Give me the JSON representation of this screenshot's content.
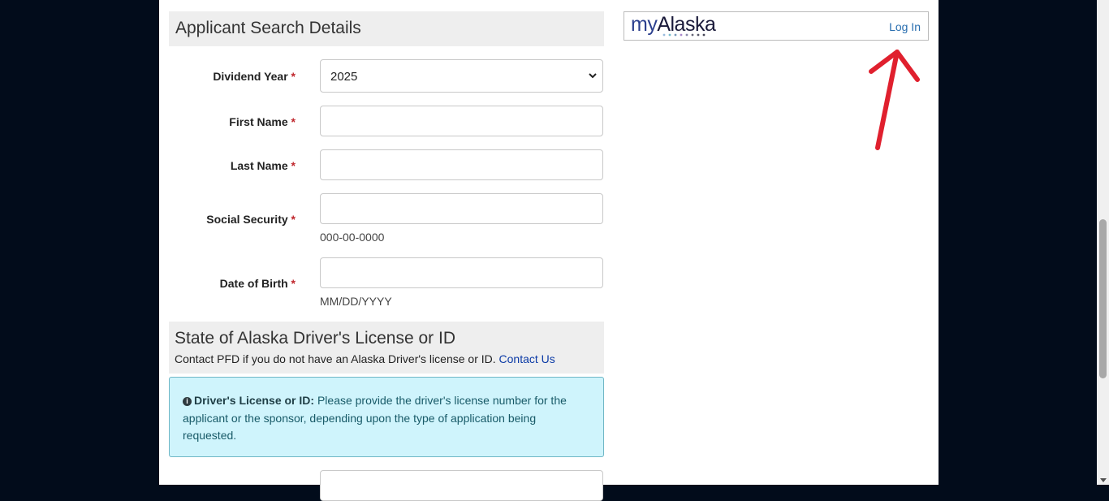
{
  "section1": {
    "title": "Applicant Search Details"
  },
  "form": {
    "dividend_year": {
      "label": "Dividend Year",
      "required": "*",
      "value": "2025"
    },
    "first_name": {
      "label": "First Name",
      "required": "*",
      "value": ""
    },
    "last_name": {
      "label": "Last Name",
      "required": "*",
      "value": ""
    },
    "ssn": {
      "label": "Social Security",
      "required": "*",
      "value": "",
      "hint": "000-00-0000"
    },
    "dob": {
      "label": "Date of Birth",
      "required": "*",
      "value": "",
      "hint": "MM/DD/YYYY"
    }
  },
  "section2": {
    "title": "State of Alaska Driver's License or ID",
    "subtitle": "Contact PFD if you do not have an Alaska Driver's license or ID.",
    "contact_link": "Contact Us"
  },
  "alert": {
    "icon": "info-icon",
    "heading": "Driver's License or ID:",
    "text": "Please provide the driver's license number for the applicant or the sponsor, depending upon the type of application being requested."
  },
  "login": {
    "logo_my": "my",
    "logo_alaska": "Alaska",
    "link": "Log In"
  },
  "colors": {
    "page_bg": "#020c1b",
    "required": "#c0272d",
    "alert_bg": "#cff4fc",
    "link": "#2a6fb0",
    "annotation_arrow": "#e0202e"
  }
}
